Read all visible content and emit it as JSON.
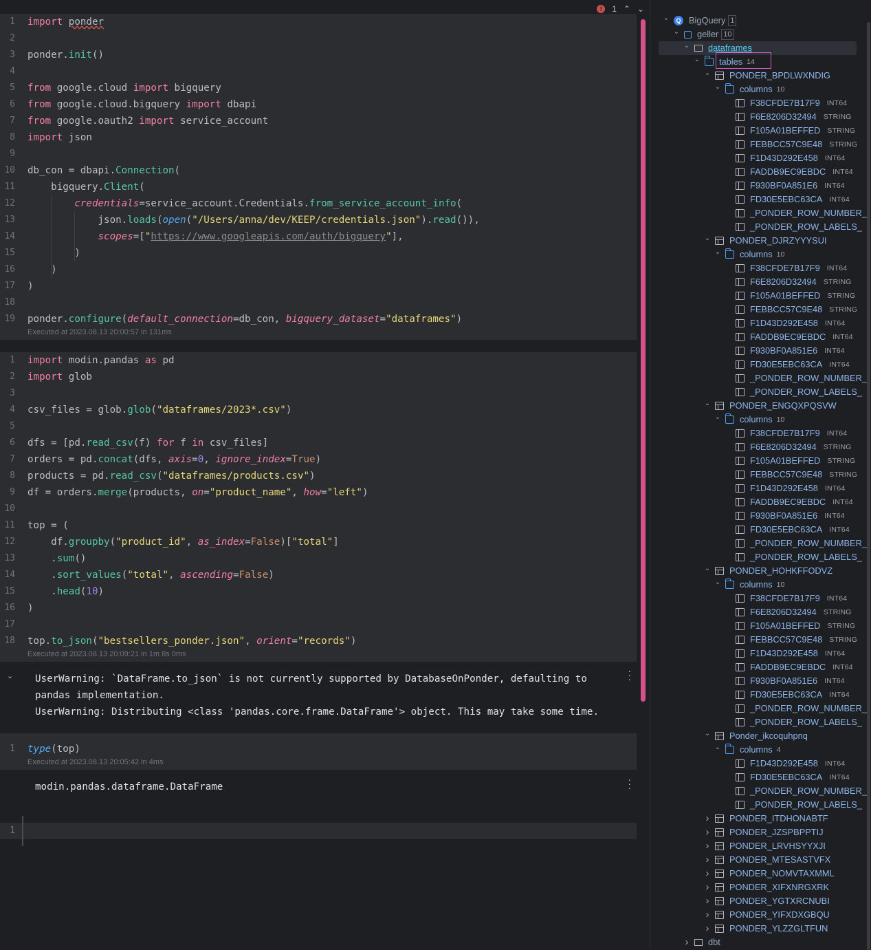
{
  "editor": {
    "problems": {
      "count": "1"
    },
    "cell1": {
      "lines": [
        {
          "n": "1"
        },
        {
          "n": "2"
        },
        {
          "n": "3"
        },
        {
          "n": "4"
        },
        {
          "n": "5"
        },
        {
          "n": "6"
        },
        {
          "n": "7"
        },
        {
          "n": "8"
        },
        {
          "n": "9"
        },
        {
          "n": "10"
        },
        {
          "n": "11"
        },
        {
          "n": "12"
        },
        {
          "n": "13"
        },
        {
          "n": "14"
        },
        {
          "n": "15"
        },
        {
          "n": "16"
        },
        {
          "n": "17"
        },
        {
          "n": "18"
        },
        {
          "n": "19"
        }
      ],
      "executed": "Executed at 2023.08.13 20:00:57 in 131ms"
    },
    "cell2": {
      "executed": "Executed at 2023.08.13 20:09:21 in 1m 8s 0ms",
      "output": [
        "UserWarning: `DataFrame.to_json` is not currently supported by DatabaseOnPonder, defaulting to",
        "pandas implementation.",
        "UserWarning: Distributing <class 'pandas.core.frame.DataFrame'> object. This may take some time."
      ]
    },
    "cell3": {
      "executed": "Executed at 2023.08.13 20:05:42 in 4ms",
      "output": "modin.pandas.dataframe.DataFrame"
    },
    "cell4": {
      "line": "1"
    }
  },
  "tree": {
    "root": {
      "label": "BigQuery",
      "count": "1"
    },
    "project": {
      "label": "geller",
      "count": "10"
    },
    "dataset": {
      "label": "dataframes"
    },
    "tables_folder": {
      "label": "tables",
      "count": "14"
    },
    "expanded_tables": [
      {
        "name": "PONDER_BPDLWXNDIG",
        "columns_label": "columns",
        "columns_count": "10",
        "columns": [
          {
            "name": "F38CFDE7B17F9",
            "type": "INT64"
          },
          {
            "name": "F6E8206D32494",
            "type": "STRING"
          },
          {
            "name": "F105A01BEFFED",
            "type": "STRING"
          },
          {
            "name": "FEBBCC57C9E48",
            "type": "STRING"
          },
          {
            "name": "F1D43D292E458",
            "type": "INT64"
          },
          {
            "name": "FADDB9EC9EBDC",
            "type": "INT64"
          },
          {
            "name": "F930BF0A851E6",
            "type": "INT64"
          },
          {
            "name": "FD30E5EBC63CA",
            "type": "INT64"
          },
          {
            "name": "_PONDER_ROW_NUMBER_",
            "type": ""
          },
          {
            "name": "_PONDER_ROW_LABELS_",
            "type": ""
          }
        ]
      },
      {
        "name": "PONDER_DJRZYYYSUI",
        "columns_label": "columns",
        "columns_count": "10",
        "columns": [
          {
            "name": "F38CFDE7B17F9",
            "type": "INT64"
          },
          {
            "name": "F6E8206D32494",
            "type": "STRING"
          },
          {
            "name": "F105A01BEFFED",
            "type": "STRING"
          },
          {
            "name": "FEBBCC57C9E48",
            "type": "STRING"
          },
          {
            "name": "F1D43D292E458",
            "type": "INT64"
          },
          {
            "name": "FADDB9EC9EBDC",
            "type": "INT64"
          },
          {
            "name": "F930BF0A851E6",
            "type": "INT64"
          },
          {
            "name": "FD30E5EBC63CA",
            "type": "INT64"
          },
          {
            "name": "_PONDER_ROW_NUMBER_",
            "type": ""
          },
          {
            "name": "_PONDER_ROW_LABELS_",
            "type": ""
          }
        ]
      },
      {
        "name": "PONDER_ENGQXPQSVW",
        "columns_label": "columns",
        "columns_count": "10",
        "columns": [
          {
            "name": "F38CFDE7B17F9",
            "type": "INT64"
          },
          {
            "name": "F6E8206D32494",
            "type": "STRING"
          },
          {
            "name": "F105A01BEFFED",
            "type": "STRING"
          },
          {
            "name": "FEBBCC57C9E48",
            "type": "STRING"
          },
          {
            "name": "F1D43D292E458",
            "type": "INT64"
          },
          {
            "name": "FADDB9EC9EBDC",
            "type": "INT64"
          },
          {
            "name": "F930BF0A851E6",
            "type": "INT64"
          },
          {
            "name": "FD30E5EBC63CA",
            "type": "INT64"
          },
          {
            "name": "_PONDER_ROW_NUMBER_",
            "type": ""
          },
          {
            "name": "_PONDER_ROW_LABELS_",
            "type": ""
          }
        ]
      },
      {
        "name": "PONDER_HOHKFFODVZ",
        "columns_label": "columns",
        "columns_count": "10",
        "columns": [
          {
            "name": "F38CFDE7B17F9",
            "type": "INT64"
          },
          {
            "name": "F6E8206D32494",
            "type": "STRING"
          },
          {
            "name": "F105A01BEFFED",
            "type": "STRING"
          },
          {
            "name": "FEBBCC57C9E48",
            "type": "STRING"
          },
          {
            "name": "F1D43D292E458",
            "type": "INT64"
          },
          {
            "name": "FADDB9EC9EBDC",
            "type": "INT64"
          },
          {
            "name": "F930BF0A851E6",
            "type": "INT64"
          },
          {
            "name": "FD30E5EBC63CA",
            "type": "INT64"
          },
          {
            "name": "_PONDER_ROW_NUMBER_",
            "type": ""
          },
          {
            "name": "_PONDER_ROW_LABELS_",
            "type": ""
          }
        ]
      },
      {
        "name": "Ponder_ikcoquhpnq",
        "columns_label": "columns",
        "columns_count": "4",
        "columns": [
          {
            "name": "F1D43D292E458",
            "type": "INT64"
          },
          {
            "name": "FD30E5EBC63CA",
            "type": "INT64"
          },
          {
            "name": "_PONDER_ROW_NUMBER_",
            "type": ""
          },
          {
            "name": "_PONDER_ROW_LABELS_",
            "type": ""
          }
        ]
      }
    ],
    "collapsed_tables": [
      "PONDER_ITDHONABTF",
      "PONDER_JZSPBPPTIJ",
      "PONDER_LRVHSYYXJI",
      "PONDER_MTESASTVFX",
      "PONDER_NOMVTAXMML",
      "PONDER_XIFXNRGXRK",
      "PONDER_YGTXRCNUBI",
      "PONDER_YIFXDXGBQU",
      "PONDER_YLZZGLTFUN"
    ],
    "other_schema": {
      "label": "dbt"
    }
  }
}
